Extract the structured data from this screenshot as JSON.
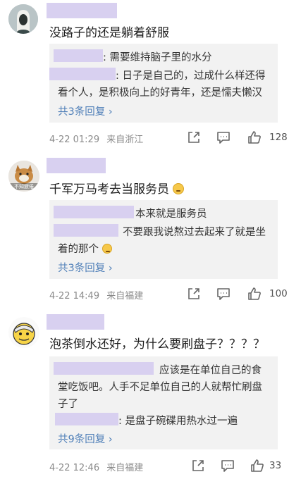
{
  "comments": [
    {
      "text": "没路子的还是躺着舒服",
      "replies": [
        {
          "text": ": 需要维持脑子里的水分"
        },
        {
          "text_l1": ": 日子是自己的，过成什么样还得",
          "text_l2": "看个人，是积极向上的好青年，还是懦夫懒汉"
        }
      ],
      "more_label": "共3条回复",
      "time": "4-22 01:29",
      "source": "来自浙江",
      "likes": "128"
    },
    {
      "text": "千军万马考去当服务员",
      "avatar_caption": "不知疲倦",
      "replies": [
        {
          "text": "本来就是服务员"
        },
        {
          "text_l1": "不要跟我说熬过去起来了就是坐",
          "text_l2": "着的那个"
        }
      ],
      "more_label": "共3条回复",
      "time": "4-22 14:49",
      "source": "来自福建",
      "likes": "100"
    },
    {
      "text": "泡茶倒水还好，为什么要刷盘子？？？？",
      "replies": [
        {
          "text_l1": "应该是在单位自己的食",
          "text_l2": "堂吃饭吧。人手不足单位自己的人就帮忙刷盘",
          "text_l3": "子了"
        },
        {
          "text": ": 是盘子碗碟用热水过一遍"
        }
      ],
      "more_label": "共9条回复",
      "time": "4-22 12:46",
      "source": "来自福建",
      "likes": "33"
    }
  ],
  "icons": [
    "share-icon",
    "comment-icon",
    "like-icon"
  ],
  "colors": {
    "redaction": "#d8d0f0",
    "link": "#4f7fb8",
    "reply_bg": "#f2f2f2",
    "meta": "#8a8a8a"
  }
}
